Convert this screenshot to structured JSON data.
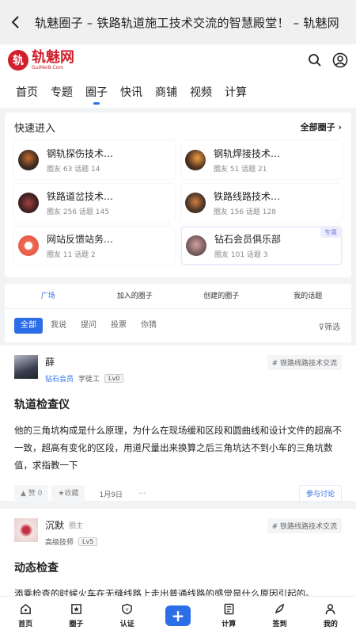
{
  "topbar": {
    "title": "轨魅圈子 – 铁路轨道施工技术交流的智慧殿堂！ – 轨魅网"
  },
  "header": {
    "logo_cn": "轨魅网",
    "logo_en": "GuiMei8.Com"
  },
  "nav": [
    {
      "label": "首页"
    },
    {
      "label": "专题"
    },
    {
      "label": "圈子",
      "active": true
    },
    {
      "label": "快讯"
    },
    {
      "label": "商铺"
    },
    {
      "label": "视频"
    },
    {
      "label": "计算"
    }
  ],
  "quick": {
    "title": "快速进入",
    "all_label": "全部圈子",
    "items": [
      {
        "name": "钢轨探伤技术…",
        "stat": "圈友 63  话题 14"
      },
      {
        "name": "钢轨焊接技术…",
        "stat": "圈友 51  话题 21"
      },
      {
        "name": "铁路道岔技术…",
        "stat": "圈友 256  话题 145"
      },
      {
        "name": "铁路线路技术…",
        "stat": "圈友 156  话题 128"
      },
      {
        "name": "网站反馈站务…",
        "stat": "圈友 11  话题 2"
      },
      {
        "name": "钻石会员俱乐部",
        "stat": "圈友 101  话题 3",
        "tag": "专属"
      }
    ]
  },
  "tabs": [
    {
      "label": "广场",
      "active": true
    },
    {
      "label": "加入的圈子"
    },
    {
      "label": "创建的圈子"
    },
    {
      "label": "我的话题"
    }
  ],
  "filters": {
    "chips": [
      {
        "label": "全部",
        "active": true
      },
      {
        "label": "我说"
      },
      {
        "label": "提问"
      },
      {
        "label": "投票"
      },
      {
        "label": "你猜"
      }
    ],
    "filter_label": "筛选"
  },
  "posts": [
    {
      "name": "薛",
      "role": "",
      "level_title": "钻石会员",
      "level_sub": "学徒工",
      "lv": "Lv0",
      "topic": "铁路线路技术交流",
      "title": "轨道检查仪",
      "body": "他的三角坑构成是什么原理，为什么在现场缓和区段和圆曲线和设计文件的超高不一致，超高有变化的区段，用道尺量出来换算之后三角坑达不到小车的三角坑数值，求指教一下",
      "like": "赞 0",
      "fav": "收藏",
      "date": "1月9日",
      "join": "参与讨论"
    },
    {
      "name": "沉默",
      "role": "圈主",
      "level_title": "",
      "level_sub": "高级技师",
      "lv": "Lv5",
      "topic": "铁路线路技术交流",
      "title": "动态检查",
      "body": "添乘检查的时候火车在无缝线路上走出普通线路的感觉是什么原因引起的。"
    }
  ],
  "bottom_nav": [
    {
      "label": "首页",
      "icon": "home-icon"
    },
    {
      "label": "圈子",
      "icon": "circle-icon"
    },
    {
      "label": "认证",
      "icon": "shield-icon"
    },
    {
      "label": "+",
      "icon": "plus-icon"
    },
    {
      "label": "计算",
      "icon": "calc-icon"
    },
    {
      "label": "签到",
      "icon": "feather-icon"
    },
    {
      "label": "我的",
      "icon": "user-icon"
    }
  ],
  "colors": {
    "accent": "#2b6ee8",
    "brand": "#d0202c"
  }
}
